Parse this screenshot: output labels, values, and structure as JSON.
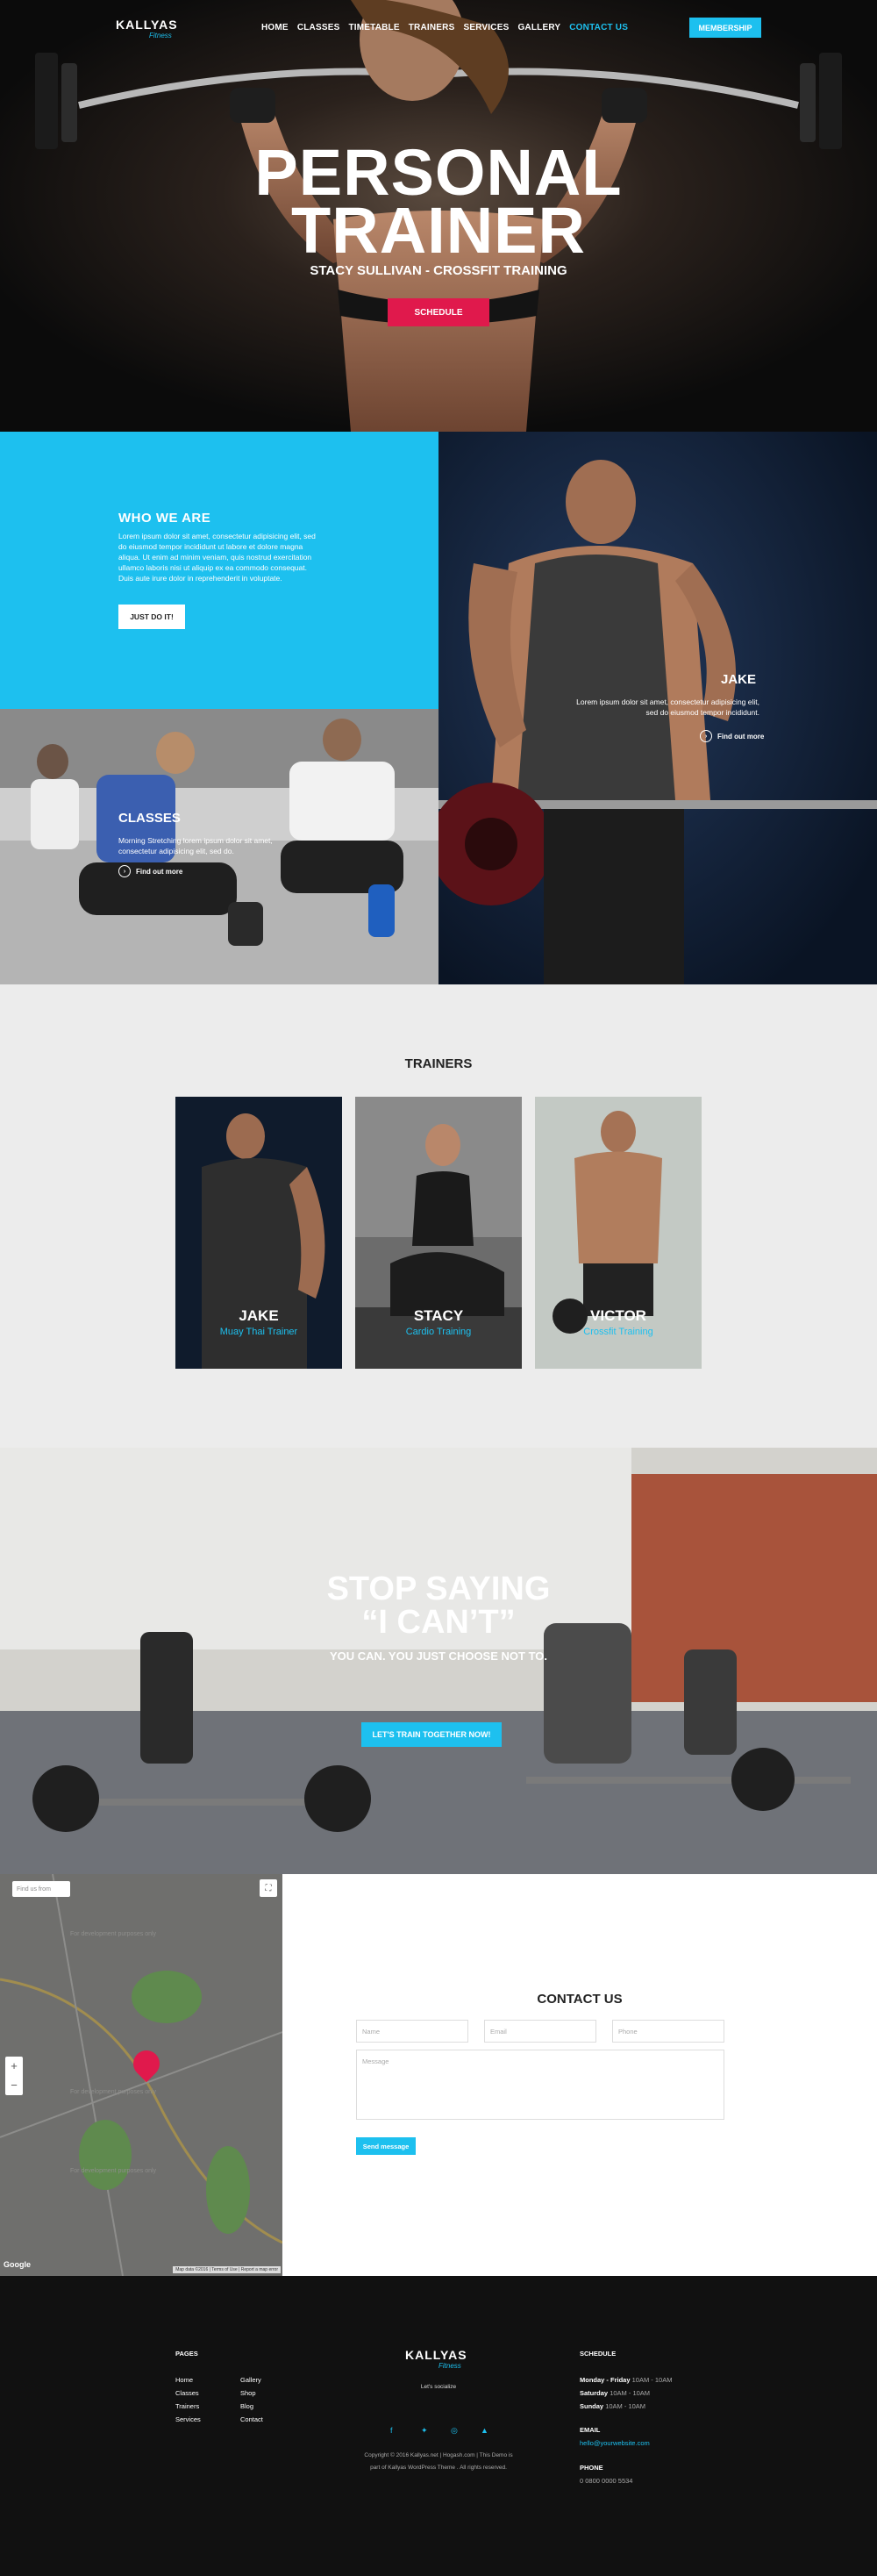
{
  "brand": {
    "name": "KALLYAS",
    "sub": "Fitness"
  },
  "nav": {
    "items": [
      "HOME",
      "CLASSES",
      "TIMETABLE",
      "TRAINERS",
      "SERVICES",
      "GALLERY",
      "CONTACT US"
    ],
    "active_index": 6,
    "membership": "MEMBERSHIP"
  },
  "hero": {
    "title_line1": "PERSONAL",
    "title_line2": "TRAINER",
    "subtitle": "STACY SULLIVAN - CROSSFIT TRAINING",
    "button": "SCHEDULE"
  },
  "who": {
    "title": "WHO WE ARE",
    "text": "Lorem ipsum dolor sit amet, consectetur adipisicing elit, sed do eiusmod tempor incididunt ut labore et dolore magna aliqua. Ut enim ad minim veniam, quis nostrud exercitation ullamco laboris nisi ut aliquip ex ea commodo consequat. Duis aute irure dolor in reprehenderit in voluptate.",
    "button": "JUST DO IT!"
  },
  "classes_feature": {
    "title": "CLASSES",
    "text": "Morning Stretching lorem ipsum dolor sit amet, consectetur adipisicing elit, sed do.",
    "link": "Find out more"
  },
  "jake_feature": {
    "title": "JAKE",
    "text": "Lorem ipsum dolor sit amet, consectetur adipisicing elit, sed do eiusmod tempor incididunt.",
    "link": "Find out more"
  },
  "trainers": {
    "title": "TRAINERS",
    "cards": [
      {
        "name": "JAKE",
        "role": "Muay Thai Trainer"
      },
      {
        "name": "STACY",
        "role": "Cardio Training"
      },
      {
        "name": "VICTOR",
        "role": "Crossfit Training"
      }
    ]
  },
  "stop": {
    "line1": "STOP SAYING",
    "line2": "“I CAN’T”",
    "line3": "YOU CAN. YOU JUST CHOOSE NOT TO.",
    "button": "LET'S TRAIN TOGETHER NOW!"
  },
  "map": {
    "search_placeholder": "Find us from",
    "watermark": "For development purposes only",
    "google": "Google",
    "terms": "Map data ©2016 | Terms of Use | Report a map error"
  },
  "contact": {
    "title": "CONTACT US",
    "name_placeholder": "Name",
    "email_placeholder": "Email",
    "phone_placeholder": "Phone",
    "message_placeholder": "Message",
    "send": "Send message"
  },
  "footer": {
    "pages_title": "PAGES",
    "pages_col1": [
      "Home",
      "Classes",
      "Trainers",
      "Services"
    ],
    "pages_col2": [
      "Gallery",
      "Shop",
      "Blog",
      "Contact"
    ],
    "tagline": "Let's socialize",
    "copyright_line1": "Copyright © 2016 Kallyas.net | Hogash.com | This Demo is",
    "copyright_line2": "part of Kallyas WordPress Theme . All rights reserved.",
    "schedule_title": "SCHEDULE",
    "schedule": [
      {
        "day": "Monday - Friday",
        "hours": "10AM - 10AM"
      },
      {
        "day": "Saturday",
        "hours": "10AM - 10AM"
      },
      {
        "day": "Sunday",
        "hours": "10AM - 10AM"
      }
    ],
    "email_title": "EMAIL",
    "email": "hello@yourwebsite.com",
    "phone_title": "PHONE",
    "phone": "0 0800 0000 5534"
  },
  "colors": {
    "accent": "#1dc0ef",
    "cta": "#e0194c",
    "footer": "#111111"
  }
}
